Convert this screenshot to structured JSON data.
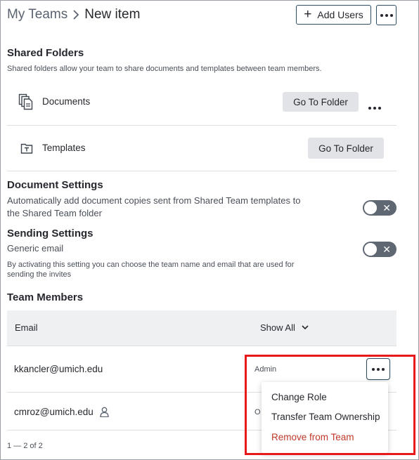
{
  "breadcrumb": {
    "parent": "My Teams",
    "current": "New item"
  },
  "header": {
    "add_users_label": "Add Users"
  },
  "shared_folders": {
    "title": "Shared Folders",
    "subtitle": "Shared folders allow your team to share documents and templates between team members.",
    "folders": [
      {
        "label": "Documents",
        "button": "Go To Folder",
        "icon": "documents-icon"
      },
      {
        "label": "Templates",
        "button": "Go To Folder",
        "icon": "templates-icon"
      }
    ]
  },
  "document_settings": {
    "title": "Document Settings",
    "description": "Automatically add document copies sent from Shared Team templates to the Shared Team folder",
    "enabled": false
  },
  "sending_settings": {
    "title": "Sending Settings",
    "option": "Generic email",
    "description": "By activating this setting you can choose the team name and email that are used for sending the invites",
    "enabled": false
  },
  "team_members": {
    "title": "Team Members",
    "columns": {
      "email": "Email",
      "filter": "Show All"
    },
    "rows": [
      {
        "email": "kkancler@umich.edu",
        "role": "Admin"
      },
      {
        "email": "cmroz@umich.edu",
        "role": "O"
      }
    ],
    "pagination": "1 — 2 of 2"
  },
  "context_menu": {
    "items": [
      "Change Role",
      "Transfer Team Ownership",
      "Remove from Team"
    ]
  },
  "colors": {
    "danger": "#c0392b",
    "highlight": "#e8191b",
    "toggle_off": "#5f6772",
    "button_grey": "#e1e3e6"
  }
}
